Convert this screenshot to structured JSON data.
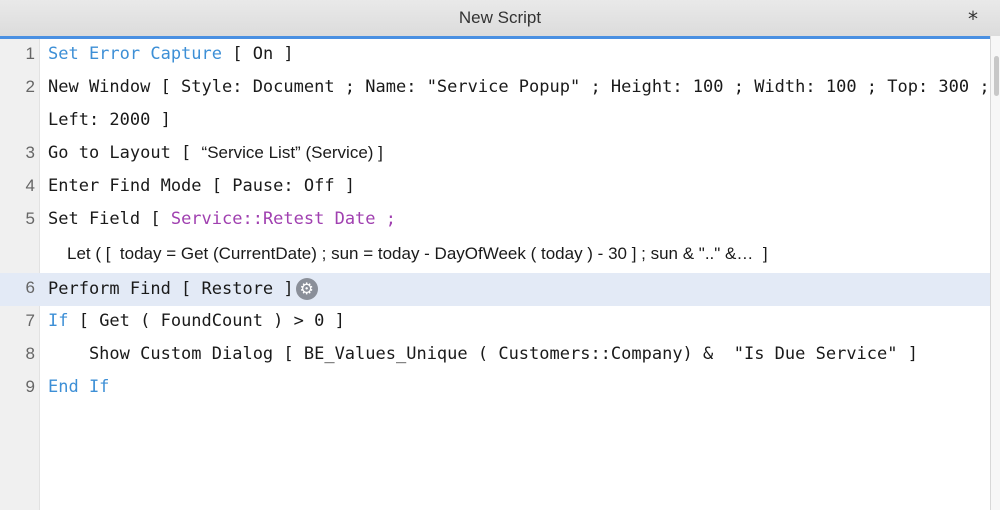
{
  "window": {
    "title": "New Script",
    "modified_indicator": "*"
  },
  "colors": {
    "step_blue": "#3d8fd6",
    "field_purple": "#a040b0",
    "highlight": "#e3eaf6",
    "active_tab_line": "#4a90e2"
  },
  "lines": [
    {
      "n": "1",
      "kw": "Set Error Capture",
      "rest": " [ On ]"
    },
    {
      "n": "2",
      "text": "New Window [ Style: Document ; Name: \"Service Popup\" ; Height: 100 ; Width: 100 ; Top: 300 ;",
      "cont": "Left: 2000 ]"
    },
    {
      "n": "3",
      "step": "Go to Layout [ ",
      "layout": "“Service List” (Service) ]"
    },
    {
      "n": "4",
      "text": "Enter Find Mode [ Pause: Off ]"
    },
    {
      "n": "5",
      "step": "Set Field [ ",
      "field": "Service::Retest Date ;",
      "cont": "Let ( [  today = Get (CurrentDate) ; sun = today - DayOfWeek ( today ) - 30 ] ; sun & \"..\" &…  ]"
    },
    {
      "n": "6",
      "text": "Perform Find [ Restore ]"
    },
    {
      "n": "7",
      "kw": "If",
      "rest": " [ Get ( FoundCount ) > 0 ]"
    },
    {
      "n": "8",
      "text": "    Show Custom Dialog [ BE_Values_Unique ( Customers::Company) &  \"Is Due Service\" ]"
    },
    {
      "n": "9",
      "kw": "End If"
    }
  ],
  "icons": {
    "options": "gear-icon"
  }
}
